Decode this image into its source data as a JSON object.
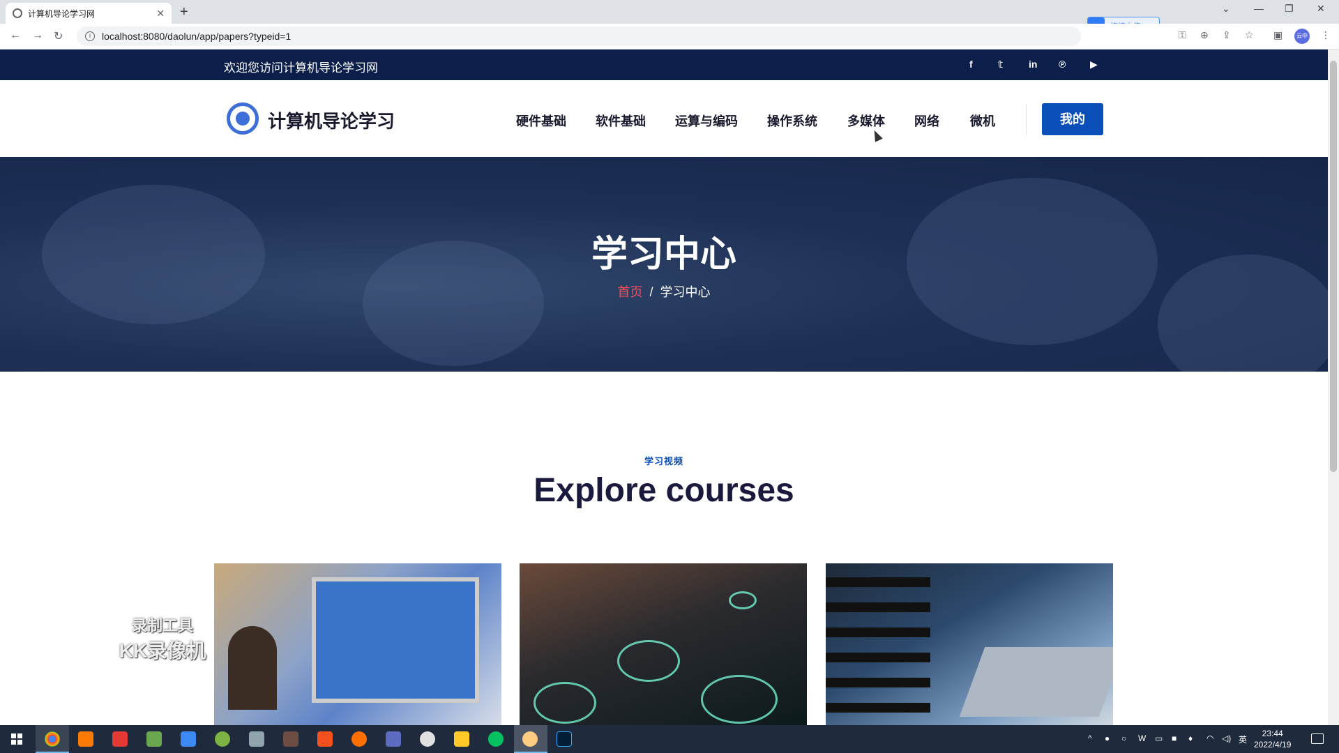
{
  "browser": {
    "tab_title": "计算机导论学习网",
    "url": "localhost:8080/daolun/app/papers?typeid=1",
    "upload_label": "拖拽上传",
    "profile_label": "云中"
  },
  "topbar": {
    "welcome": "欢迎您访问计算机导论学习网",
    "social_icons": [
      "facebook-icon",
      "twitter-icon",
      "linkedin-icon",
      "pinterest-icon",
      "youtube-icon"
    ]
  },
  "header": {
    "logo_text": "计算机导论学习",
    "nav": [
      "硬件基础",
      "软件基础",
      "运算与编码",
      "操作系统",
      "多媒体",
      "网络",
      "微机"
    ],
    "mine_button": "我的"
  },
  "hero": {
    "title": "学习中心",
    "breadcrumb_home": "首页",
    "breadcrumb_sep": "/",
    "breadcrumb_current": "学习中心"
  },
  "courses": {
    "eyebrow": "学习视频",
    "title": "Explore courses"
  },
  "watermark": {
    "line1": "录制工具",
    "line2": "KK录像机"
  },
  "taskbar": {
    "time": "23:44",
    "date": "2022/4/19",
    "ime": "英"
  },
  "colors": {
    "topbar_bg": "#0c1f4a",
    "accent": "#0a4fb8",
    "breadcrumb_home": "#ff4d5a"
  }
}
